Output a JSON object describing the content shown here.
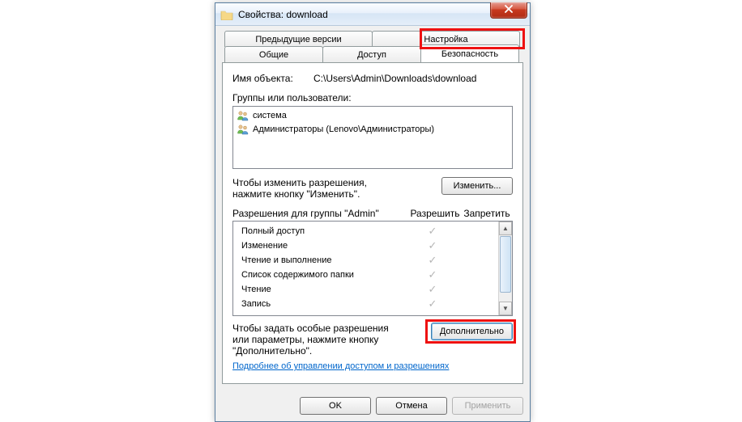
{
  "titlebar": {
    "title": "Свойства: download"
  },
  "tabs": {
    "row_top": [
      "Предыдущие версии",
      "Настройка"
    ],
    "row_bottom": [
      "Общие",
      "Доступ",
      "Безопасность"
    ],
    "active": "Безопасность"
  },
  "object": {
    "label": "Имя объекта:",
    "value": "C:\\Users\\Admin\\Downloads\\download"
  },
  "groups": {
    "label": "Группы или пользователи:",
    "items": [
      {
        "name": "система",
        "icon": "user-group"
      },
      {
        "name": "Администраторы (Lenovo\\Администраторы)",
        "icon": "user-group"
      }
    ]
  },
  "edit": {
    "hint": "Чтобы изменить разрешения, нажмите кнопку \"Изменить\".",
    "button": "Изменить..."
  },
  "permissions": {
    "header_label": "Разрешения для группы \"Admin\"",
    "col_allow": "Разрешить",
    "col_deny": "Запретить",
    "rows": [
      {
        "name": "Полный доступ",
        "allow": true,
        "deny": false
      },
      {
        "name": "Изменение",
        "allow": true,
        "deny": false
      },
      {
        "name": "Чтение и выполнение",
        "allow": true,
        "deny": false
      },
      {
        "name": "Список содержимого папки",
        "allow": true,
        "deny": false
      },
      {
        "name": "Чтение",
        "allow": true,
        "deny": false
      },
      {
        "name": "Запись",
        "allow": true,
        "deny": false
      }
    ]
  },
  "advanced": {
    "hint": "Чтобы задать особые разрешения или параметры, нажмите кнопку \"Дополнительно\".",
    "button": "Дополнительно"
  },
  "link": "Подробнее об управлении доступом и разрешениях",
  "buttons": {
    "ok": "OK",
    "cancel": "Отмена",
    "apply": "Применить"
  }
}
